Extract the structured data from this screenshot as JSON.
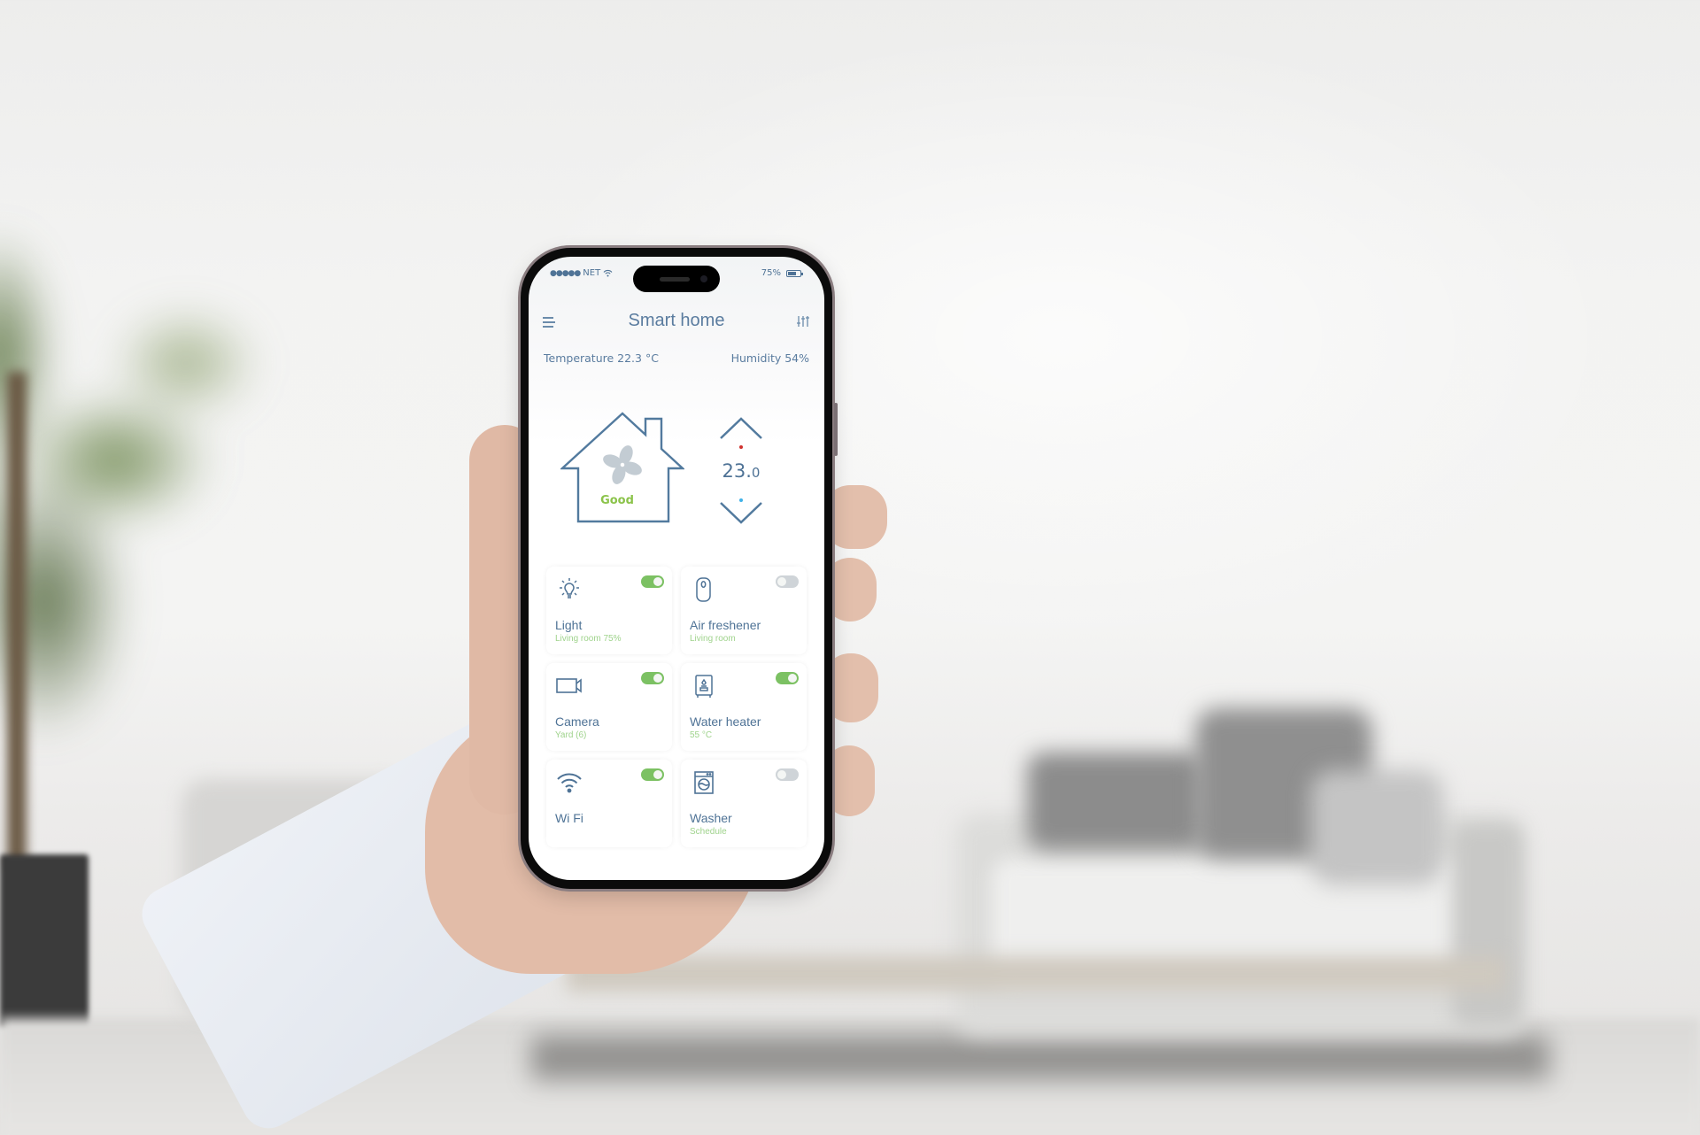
{
  "status_bar": {
    "signal_dots": "●●●●●",
    "carrier": "NET",
    "wifi_icon": "wifi-icon",
    "battery_percent_label": "75%",
    "battery_level": 0.75
  },
  "app_bar": {
    "title": "Smart home",
    "menu_icon": "hamburger-menu-icon",
    "filter_icon": "sliders-icon"
  },
  "environment": {
    "temperature_label": "Temperature 22.3 °C",
    "humidity_label": "Humidity 54%"
  },
  "air_quality": {
    "status": "Good",
    "icon": "fan-icon"
  },
  "thermostat": {
    "setpoint_int": "23.",
    "setpoint_dec": "0",
    "increase_icon": "chevron-up-icon",
    "decrease_icon": "chevron-down-icon"
  },
  "devices": [
    {
      "name": "Light",
      "sub": "Living room 75%",
      "icon": "lightbulb-icon",
      "on": true
    },
    {
      "name": "Air freshener",
      "sub": "Living room",
      "icon": "air-freshener-icon",
      "on": false
    },
    {
      "name": "Camera",
      "sub": "Yard (6)",
      "icon": "video-camera-icon",
      "on": true
    },
    {
      "name": "Water heater",
      "sub": "55 °C",
      "icon": "water-heater-icon",
      "on": true
    },
    {
      "name": "Wi Fi",
      "sub": "",
      "icon": "wifi-icon",
      "on": true
    },
    {
      "name": "Washer",
      "sub": "Schedule",
      "icon": "washing-machine-icon",
      "on": false
    }
  ],
  "colors": {
    "primary_text": "#4f7396",
    "accent_green": "#7cc163",
    "sub_green": "#9fd38c",
    "toggle_off": "#cfd4d8",
    "dot_red": "#d0312d",
    "dot_blue": "#3fb2e8"
  }
}
